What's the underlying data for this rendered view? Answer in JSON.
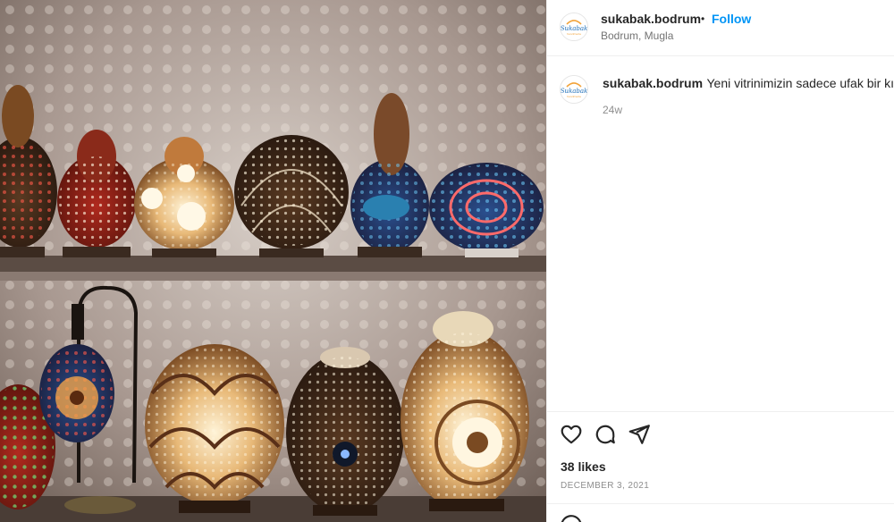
{
  "post": {
    "username": "sukabak.bodrum",
    "separator": "•",
    "follow_label": "Follow",
    "location": "Bodrum, Mugla",
    "avatar_logo_text": "Sukabak",
    "avatar_logo_subtext": "handmade",
    "caption": {
      "username": "sukabak.bodrum",
      "text": "Yeni vitrinimizin sadece ufak bir kısm",
      "age": "24w"
    },
    "likes": "38 likes",
    "date": "DECEMBER 3, 2021"
  },
  "image": {
    "subject": "Shelves of handmade gourd lamps with dotted light patterns"
  },
  "icons": {
    "like": "heart-icon",
    "comment": "comment-icon",
    "share": "share-icon",
    "emoji": "emoji-icon"
  },
  "colors": {
    "accent": "#0095f6",
    "text": "#262626",
    "secondary": "#737373",
    "divider": "#efefef"
  }
}
